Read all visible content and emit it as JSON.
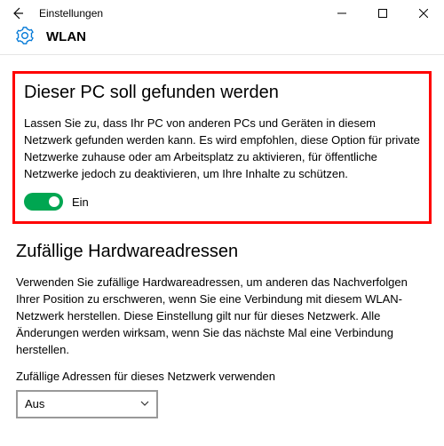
{
  "titlebar": {
    "label": "Einstellungen"
  },
  "header": {
    "page_title": "WLAN"
  },
  "section1": {
    "heading": "Dieser PC soll gefunden werden",
    "description": "Lassen Sie zu, dass Ihr PC von anderen PCs und Geräten in diesem Netzwerk gefunden werden kann. Es wird empfohlen, diese Option für private Netzwerke zuhause oder am Arbeitsplatz zu aktivieren, für öffentliche Netzwerke jedoch zu deaktivieren, um Ihre Inhalte zu schützen.",
    "toggle_state": "Ein"
  },
  "section2": {
    "heading": "Zufällige Hardwareadressen",
    "description": "Verwenden Sie zufällige Hardwareadressen, um anderen das Nachverfolgen Ihrer Position zu erschweren, wenn Sie eine Verbindung mit diesem WLAN-Netzwerk herstellen. Diese Einstellung gilt nur für dieses Netzwerk. Alle Änderungen werden wirksam, wenn Sie das nächste Mal eine Verbindung herstellen.",
    "select_label": "Zufällige Adressen für dieses Netzwerk verwenden",
    "select_value": "Aus"
  }
}
